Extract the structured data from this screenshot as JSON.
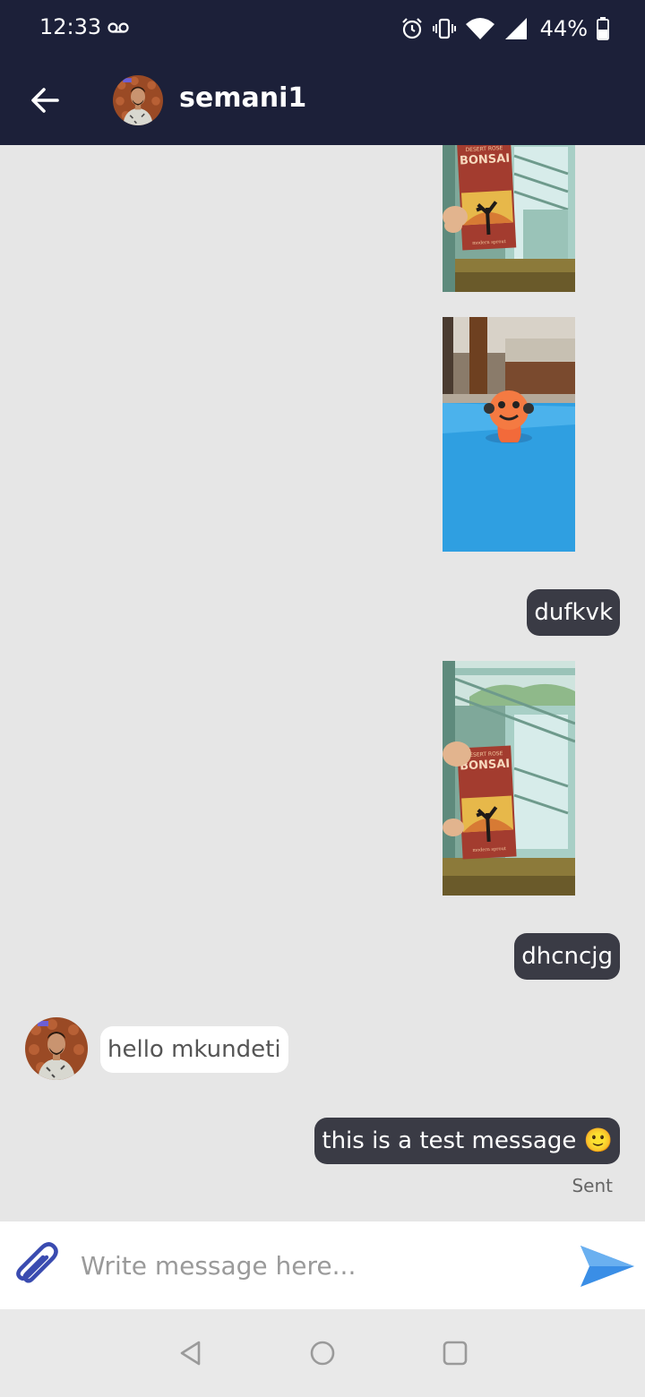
{
  "status_bar": {
    "time": "12:33",
    "battery": "44%",
    "icons": [
      "voicemail-icon",
      "alarm-icon",
      "vibrate-icon",
      "wifi-icon",
      "signal-icon",
      "battery-icon"
    ]
  },
  "header": {
    "contact_name": "semani1",
    "back_icon": "arrow-left-icon"
  },
  "messages": [
    {
      "type": "image",
      "direction": "outgoing",
      "subject": "Desert Rose Bonsai card by window"
    },
    {
      "type": "image",
      "direction": "outgoing",
      "subject": "orange toy on blue surface"
    },
    {
      "type": "text",
      "direction": "outgoing",
      "text": "dufkvk"
    },
    {
      "type": "image",
      "direction": "outgoing",
      "subject": "Desert Rose Bonsai card by window"
    },
    {
      "type": "text",
      "direction": "outgoing",
      "text": "dhcncjg"
    },
    {
      "type": "text",
      "direction": "incoming",
      "text": "hello mkundeti"
    },
    {
      "type": "text",
      "direction": "outgoing",
      "text": "this is a test message 🙂",
      "status": "Sent"
    }
  ],
  "photo_text": {
    "card_brand_top": "DESERT ROSE",
    "card_brand": "BONSAI",
    "card_footer": "modern sprout"
  },
  "composer": {
    "placeholder": "Write message here...",
    "value": "",
    "attach_icon": "paperclip-icon",
    "send_icon": "send-icon"
  },
  "colors": {
    "header_bg": "#1c2039",
    "chat_bg": "#e6e6e6",
    "outgoing_bubble": "#3a3b45",
    "incoming_bubble": "#ffffff",
    "send_accent": "#3a8ee6",
    "attach_accent": "#3a4bb0"
  }
}
